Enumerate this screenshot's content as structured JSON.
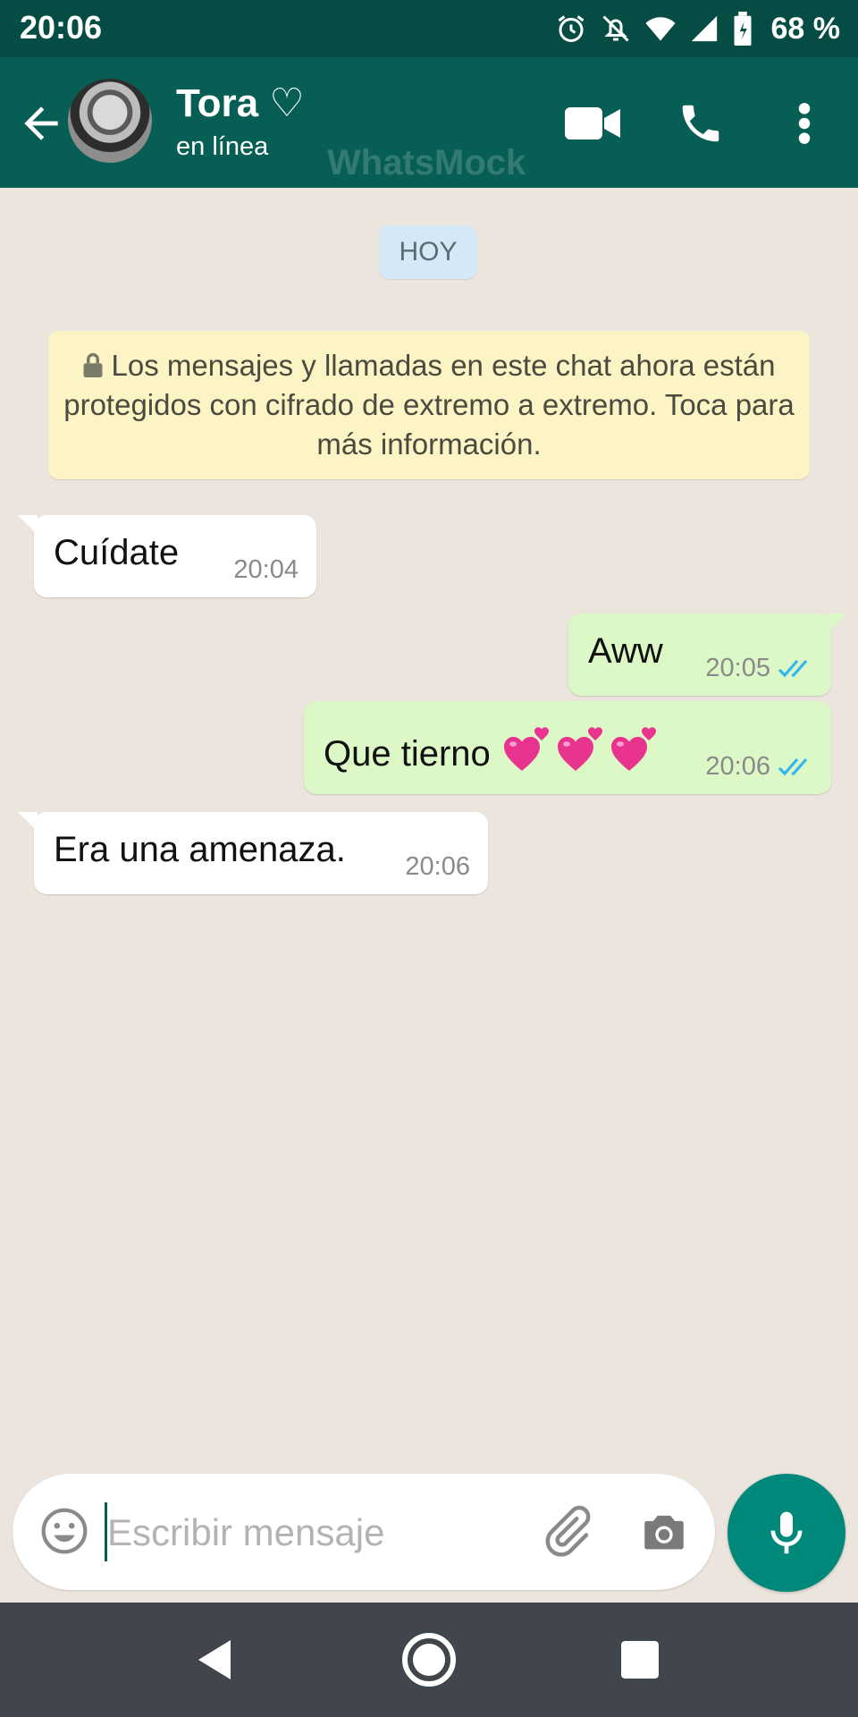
{
  "status_bar": {
    "time": "20:06",
    "battery": "68 %",
    "icons": [
      "alarm-icon",
      "notifications-off-icon",
      "wifi-icon",
      "signal-icon",
      "battery-icon"
    ]
  },
  "header": {
    "contact_name": "Tora ♡",
    "contact_status": "en línea",
    "watermark": "WhatsMock",
    "icons": [
      "back-arrow-icon",
      "video-call-icon",
      "phone-icon",
      "more-vert-icon"
    ]
  },
  "chat": {
    "date_chip": "HOY",
    "encryption_notice": "Los mensajes y llamadas en este chat ahora están protegidos con cifrado de extremo a extremo. Toca para más información.",
    "messages": [
      {
        "direction": "incoming",
        "text": "Cuídate",
        "time": "20:04"
      },
      {
        "direction": "outgoing",
        "text": "Aww",
        "time": "20:05",
        "ticks": "read"
      },
      {
        "direction": "outgoing",
        "text": "Que tierno",
        "emoji": "💞💞💞",
        "time": "20:06",
        "ticks": "read"
      },
      {
        "direction": "incoming",
        "text": "Era una amenaza.",
        "time": "20:06"
      }
    ]
  },
  "composer": {
    "placeholder": "Escribir mensaje",
    "value": "",
    "icons": [
      "emoji-icon",
      "attach-icon",
      "camera-icon",
      "mic-icon"
    ]
  },
  "nav_bar": {
    "icons": [
      "nav-back-icon",
      "nav-home-icon",
      "nav-recents-icon"
    ]
  },
  "colors": {
    "header": "#075e54",
    "status_bar": "#054d44",
    "chat_bg": "#ece5dd",
    "outgoing_bubble": "#dcf8c6",
    "incoming_bubble": "#ffffff",
    "notice_bg": "#fdf4c5",
    "date_chip_bg": "#d4e9f5",
    "read_ticks": "#34b7f1",
    "mic_button": "#00897b"
  }
}
